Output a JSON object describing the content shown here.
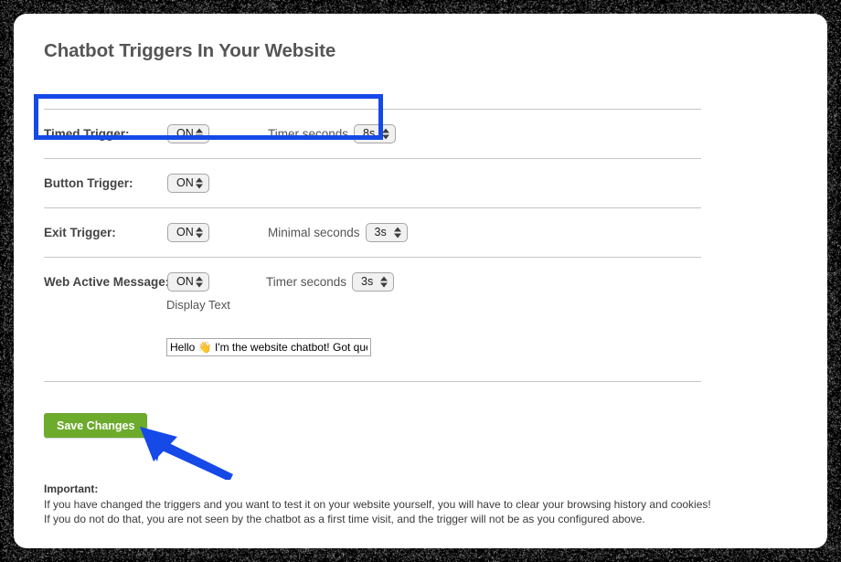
{
  "page": {
    "title": "Chatbot Triggers In Your Website"
  },
  "triggers": [
    {
      "label": "Timed Trigger:",
      "state_value": "ON",
      "seconds_label": "Timer seconds",
      "seconds_value": "8s",
      "highlighted": true
    },
    {
      "label": "Button Trigger:",
      "state_value": "ON",
      "seconds_label": "",
      "seconds_value": "",
      "highlighted": false
    },
    {
      "label": "Exit Trigger:",
      "state_value": "ON",
      "seconds_label": "Minimal seconds",
      "seconds_value": "3s",
      "highlighted": false
    },
    {
      "label": "Web Active Message:",
      "state_value": "ON",
      "seconds_label": "Timer seconds",
      "seconds_value": "3s",
      "highlighted": false
    }
  ],
  "display_text": {
    "label": "Display Text",
    "value": "Hello 👋 I'm the website chatbot! Got questions?"
  },
  "actions": {
    "save_label": "Save Changes"
  },
  "important": {
    "heading": "Important:",
    "line1": "If you have changed the triggers and you want to test it on your website yourself, you will have to clear your browsing history and cookies!",
    "line2": "If you do not do that, you are not seen by the chatbot as a first time visit, and the trigger will not be as you configured above."
  },
  "colors": {
    "highlight_blue": "#1549e8",
    "arrow_blue": "#1549e8",
    "save_green": "#6cab2c",
    "title_gray": "#555555",
    "divider_gray": "#c6c6c6",
    "frame_black": "#000000"
  }
}
